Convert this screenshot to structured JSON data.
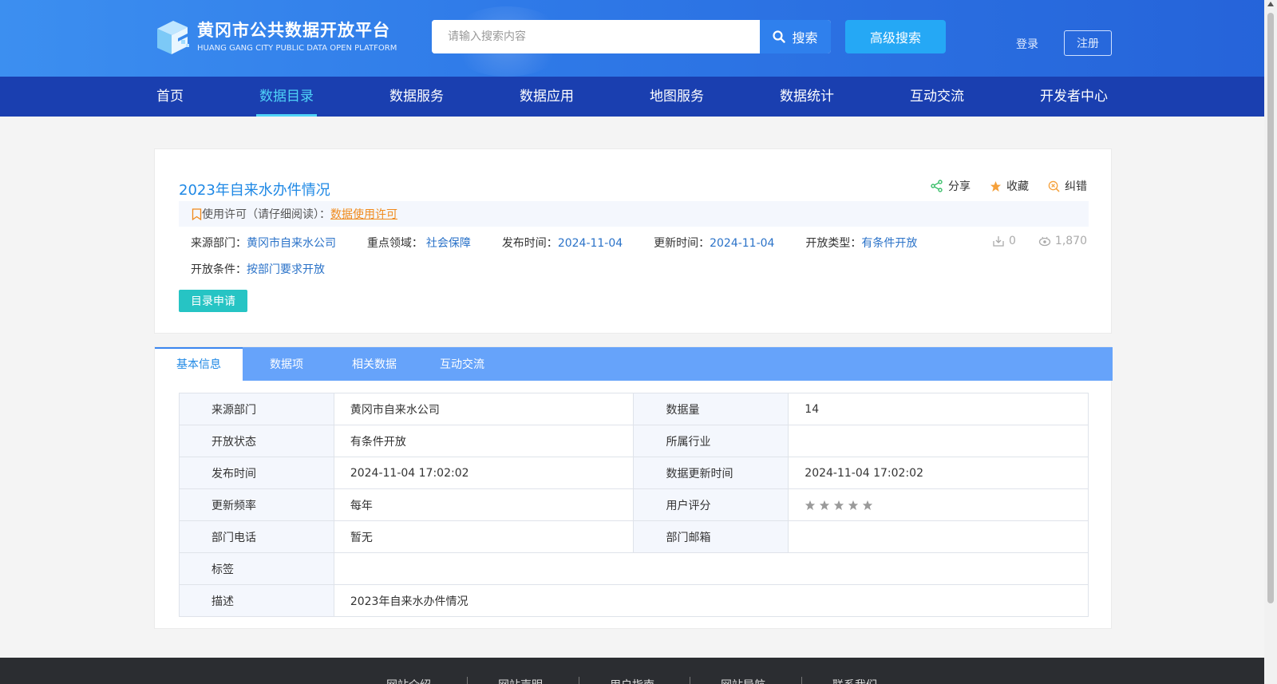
{
  "header": {
    "logo_title": "黄冈市公共数据开放平台",
    "logo_subtitle": "HUANG GANG CITY PUBLIC DATA OPEN  PLATFORM",
    "search_placeholder": "请输入搜索内容",
    "search_label": "搜索",
    "advanced_search_label": "高级搜索",
    "login_label": "登录",
    "register_label": "注册"
  },
  "nav": {
    "items": [
      {
        "label": "首页"
      },
      {
        "label": "数据目录"
      },
      {
        "label": "数据服务"
      },
      {
        "label": "数据应用"
      },
      {
        "label": "地图服务"
      },
      {
        "label": "数据统计"
      },
      {
        "label": "互动交流"
      },
      {
        "label": "开发者中心"
      }
    ],
    "active": "数据目录"
  },
  "dataset": {
    "title": "2023年自来水办件情况",
    "share_label": "分享",
    "favorite_label": "收藏",
    "report_label": "纠错",
    "license_prefix": "使用许可（请仔细阅读）：",
    "license_link": "数据使用许可",
    "source_label": "来源部门：",
    "source_value": "黄冈市自来水公司",
    "domain_label": "重点领域：",
    "domain_value": "社会保障",
    "publish_label": "发布时间：",
    "publish_value": "2024-11-04",
    "update_label": "更新时间：",
    "update_value": "2024-11-04",
    "open_type_label": "开放类型：",
    "open_type_value": "有条件开放",
    "open_condition_label": "开放条件：",
    "open_condition_value": "按部门要求开放",
    "downloads": "0",
    "views": "1,870",
    "apply_label": "目录申请"
  },
  "tabs": [
    {
      "label": "基本信息"
    },
    {
      "label": "数据项"
    },
    {
      "label": "相关数据"
    },
    {
      "label": "互动交流"
    }
  ],
  "info": {
    "r1": {
      "k1": "来源部门",
      "v1": "黄冈市自来水公司",
      "k2": "数据量",
      "v2": "14"
    },
    "r2": {
      "k1": "开放状态",
      "v1": "有条件开放",
      "k2": "所属行业",
      "v2": ""
    },
    "r3": {
      "k1": "发布时间",
      "v1": "2024-11-04 17:02:02",
      "k2": "数据更新时间",
      "v2": "2024-11-04 17:02:02"
    },
    "r4": {
      "k1": "更新频率",
      "v1": "每年",
      "k2": "用户评分",
      "rating": 0
    },
    "r5": {
      "k1": "部门电话",
      "v1": "暂无",
      "k2": "部门邮箱",
      "v2": ""
    },
    "r6": {
      "k1": "标签",
      "v1": ""
    },
    "r7": {
      "k1": "描述",
      "v1": "2023年自来水办件情况"
    }
  },
  "footer": {
    "links": [
      {
        "label": "网站介绍"
      },
      {
        "label": "网站声明"
      },
      {
        "label": "用户指南"
      },
      {
        "label": "网站导航"
      },
      {
        "label": "联系我们"
      }
    ]
  },
  "colors": {
    "header_blue": "#2f7ae8",
    "nav_blue": "#1a3fb0",
    "nav_active": "#4fd3f7",
    "link_blue": "#2a72c8",
    "title_blue": "#1e88e5",
    "license_orange": "#f08a1c",
    "apply_teal": "#26c4c4",
    "tab_blue": "#66a3fa"
  }
}
